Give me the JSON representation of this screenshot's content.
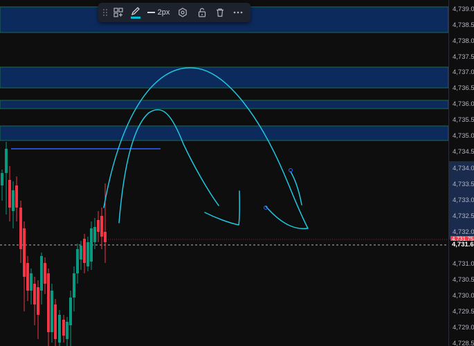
{
  "toolbar": {
    "line_width_label": "2px",
    "items": [
      "drag-handle-icon",
      "add-template-icon",
      "pencil-icon",
      "line-width",
      "settings-icon",
      "unlock-icon",
      "trash-icon",
      "more-icon"
    ],
    "accent_color": "#00bcd4"
  },
  "price_axis": {
    "ticks": [
      "4,739.00",
      "4,738.50",
      "4,738.00",
      "4,737.50",
      "4,737.00",
      "4,736.50",
      "4,736.00",
      "4,735.50",
      "4,735.00",
      "4,734.50",
      "4,734.00",
      "4,733.50",
      "4,733.00",
      "4,732.50",
      "4,732.00",
      "4,731.62",
      "4,731.00",
      "4,730.50",
      "4,730.00",
      "4,729.50",
      "4,729.00",
      "4,728.50"
    ],
    "current_price_label": "4,731.62",
    "red_marker_label": "4,731.75"
  },
  "colors": {
    "up_candle": "#089981",
    "down_candle": "#f23645",
    "zone_fill": "#0d2a5c",
    "zone_border": "#1e6b4a",
    "drawing": "#1ec8e0",
    "level_line": "#2962ff",
    "axis_text": "#b2b5be"
  }
}
